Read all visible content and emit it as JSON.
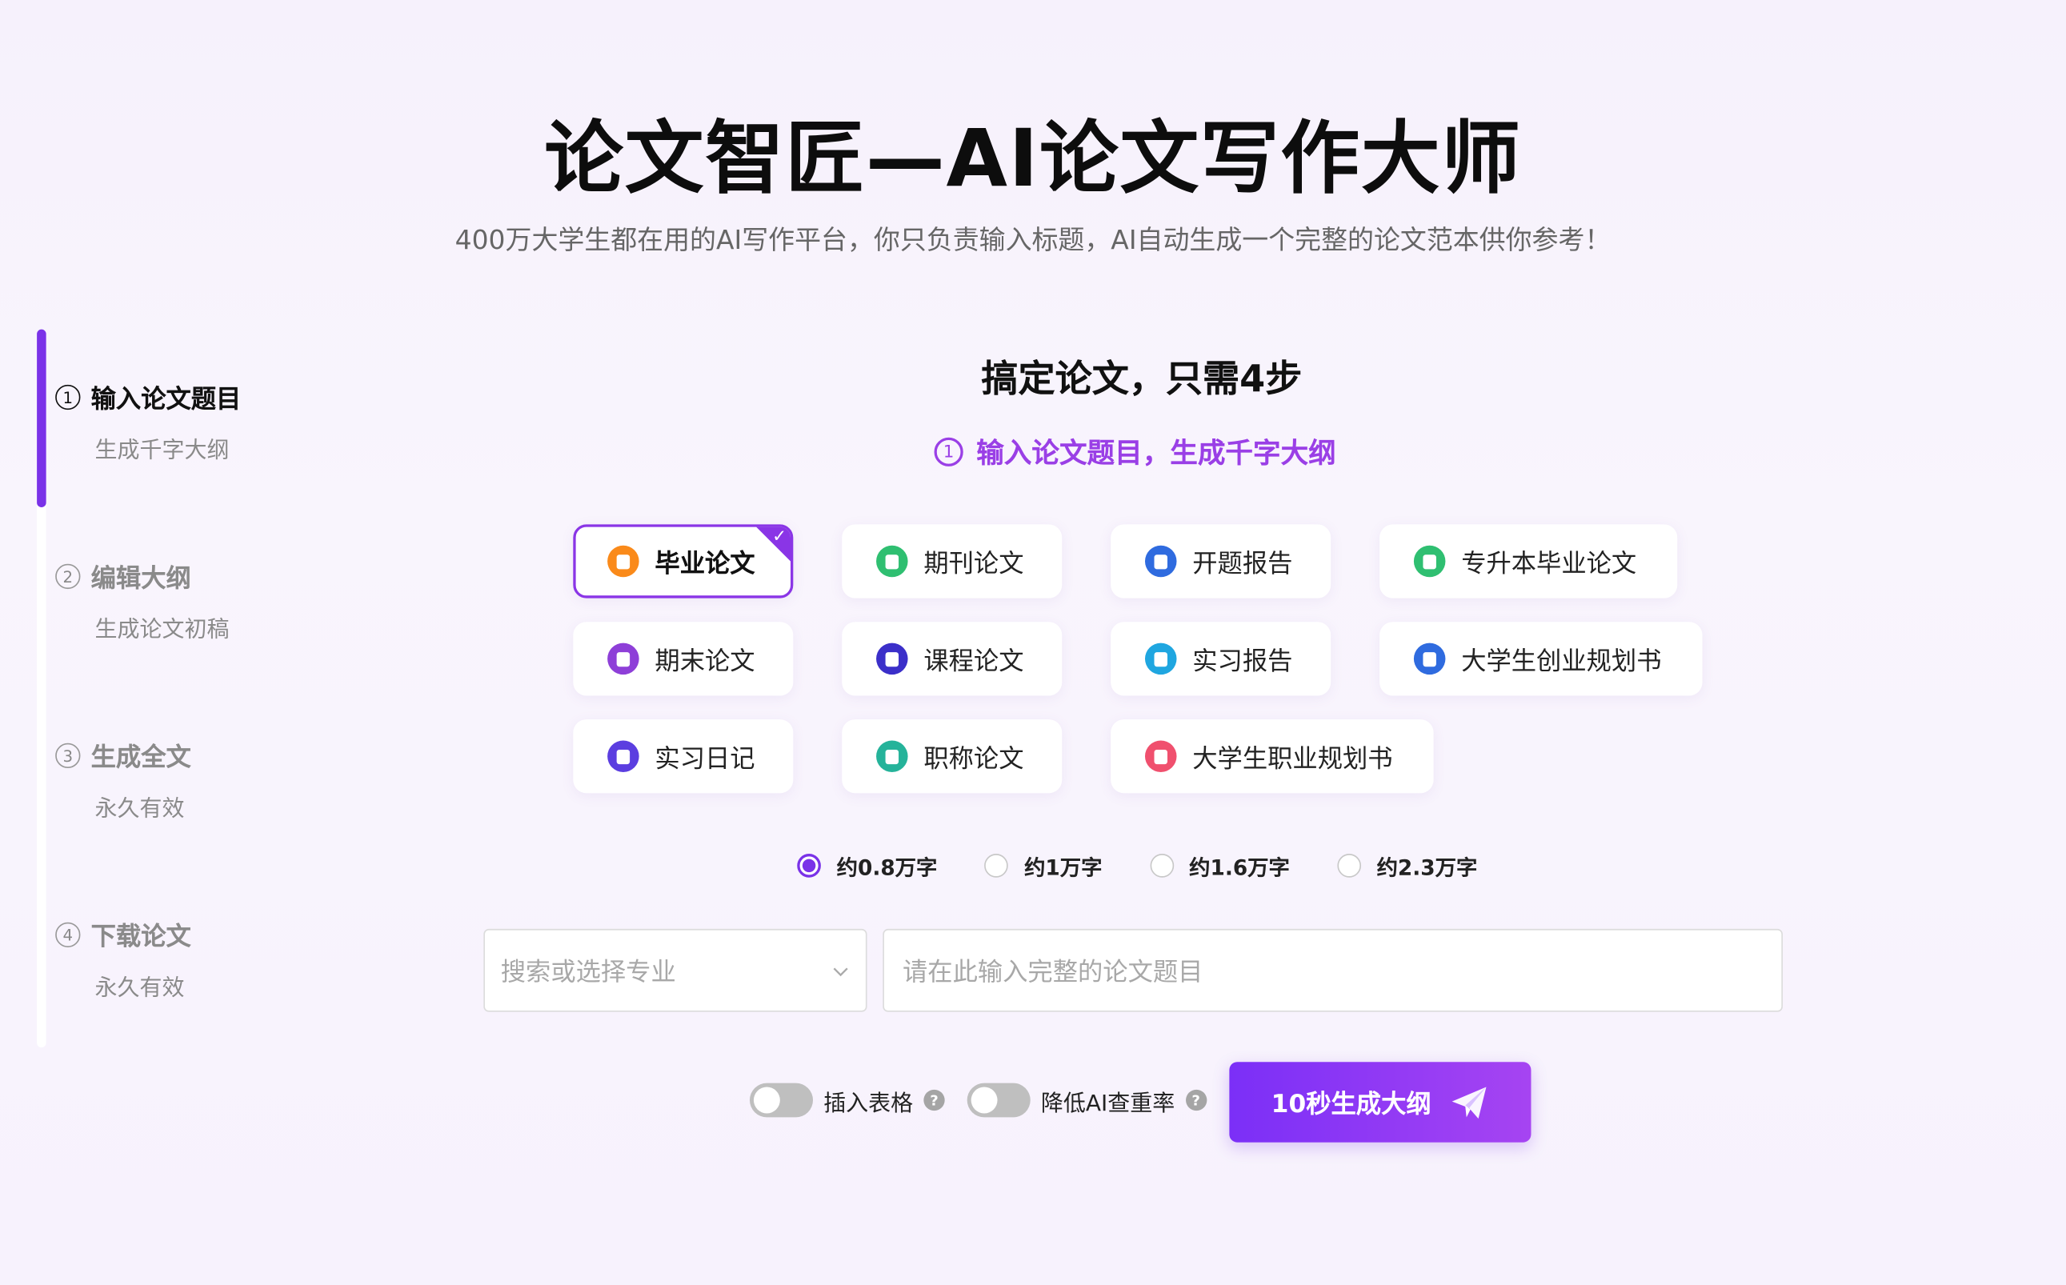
{
  "title": "论文智匠—AI论文写作大师",
  "subtitle": "400万大学生都在用的AI写作平台，你只负责输入标题，AI自动生成一个完整的论文范本供你参考！",
  "steps": [
    {
      "num": "1",
      "label": "输入论文题目",
      "sub": "生成千字大纲"
    },
    {
      "num": "2",
      "label": "编辑大纲",
      "sub": "生成论文初稿"
    },
    {
      "num": "3",
      "label": "生成全文",
      "sub": "永久有效"
    },
    {
      "num": "4",
      "label": "下载论文",
      "sub": "永久有效"
    }
  ],
  "heading": "搞定论文，只需4步",
  "step_hint": {
    "num": "1",
    "text": "输入论文题目，生成千字大纲"
  },
  "types": [
    {
      "label": "毕业论文",
      "color": "#fa8a1a",
      "icon": "graduation-paper-icon"
    },
    {
      "label": "期刊论文",
      "color": "#2fbf71",
      "icon": "journal-icon"
    },
    {
      "label": "开题报告",
      "color": "#2f6bdf",
      "icon": "proposal-icon"
    },
    {
      "label": "专升本毕业论文",
      "color": "#2fbf71",
      "icon": "book-icon"
    },
    {
      "label": "期末论文",
      "color": "#8e3fd8",
      "icon": "final-paper-icon"
    },
    {
      "label": "课程论文",
      "color": "#3b2fc9",
      "icon": "course-icon"
    },
    {
      "label": "实习报告",
      "color": "#1fa6e0",
      "icon": "report-icon"
    },
    {
      "label": "大学生创业规划书",
      "color": "#2f6bdf",
      "icon": "business-plan-icon"
    },
    {
      "label": "实习日记",
      "color": "#5b3ee0",
      "icon": "diary-icon"
    },
    {
      "label": "职称论文",
      "color": "#25b39a",
      "icon": "title-paper-icon"
    },
    {
      "label": "大学生职业规划书",
      "color": "#f0506e",
      "icon": "career-plan-icon"
    }
  ],
  "lengths": [
    {
      "label": "约0.8万字",
      "selected": true
    },
    {
      "label": "约1万字",
      "selected": false
    },
    {
      "label": "约1.6万字",
      "selected": false
    },
    {
      "label": "约2.3万字",
      "selected": false
    }
  ],
  "major_placeholder": "搜索或选择专业",
  "topic_placeholder": "请在此输入完整的论文题目",
  "toggles": {
    "table": "插入表格",
    "reduce": "降低AI查重率"
  },
  "generate_button": "10秒生成大纲",
  "colors": {
    "accent": "#7a32e8",
    "hint": "#9a3fe6"
  }
}
